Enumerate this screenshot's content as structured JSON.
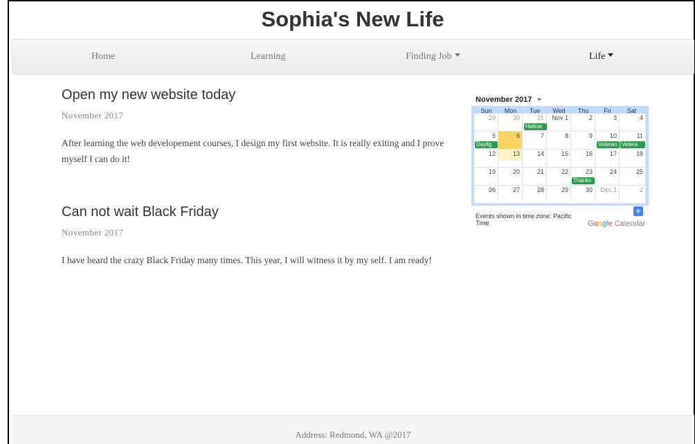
{
  "site": {
    "title": "Sophia's New Life"
  },
  "nav": {
    "items": [
      {
        "label": "Home"
      },
      {
        "label": "Learning"
      },
      {
        "label": "Finding Job"
      },
      {
        "label": "Life"
      }
    ]
  },
  "posts": [
    {
      "title": "Open my new website today",
      "date": "November  2017",
      "body": "After learning the web developement courses, I design my first website. It is really exiting and I prove myself I can do it!"
    },
    {
      "title": "Can not wait Black Friday",
      "date": "November  2017",
      "body": "I have heard the crazy Black Friday many times. This year, I will witness it by my self. I am ready!"
    }
  ],
  "calendar": {
    "month_label": "November 2017",
    "weekdays": [
      "Sun",
      "Mon",
      "Tue",
      "Wed",
      "Thu",
      "Fri",
      "Sat"
    ],
    "weeks": [
      [
        "29",
        "30",
        "31",
        "Nov 1",
        "2",
        "3",
        "4"
      ],
      [
        "5",
        "6",
        "7",
        "8",
        "9",
        "10",
        "11"
      ],
      [
        "12",
        "13",
        "14",
        "15",
        "16",
        "17",
        "18"
      ],
      [
        "19",
        "20",
        "21",
        "22",
        "23",
        "24",
        "25"
      ],
      [
        "26",
        "27",
        "28",
        "29",
        "30",
        "Dec 1",
        "2"
      ]
    ],
    "events": {
      "halloween": "Hallow",
      "daylight": "Daylig",
      "veterans_fri": "Veteran",
      "veterans_sat": "Vetera",
      "thanksgiving": "Thanks"
    },
    "timezone_note": "Events shown in time zone: Pacific Time",
    "brand": {
      "g1": "G",
      "o1": "o",
      "o2": "o",
      "g2": "g",
      "l": "l",
      "e": "e",
      "rest": " Calendar"
    },
    "add_symbol": "+",
    "colors": {
      "header_bg": "#c3d9ff",
      "event": "#2e9a4f",
      "today": "#fad163"
    }
  },
  "footer": {
    "text": "Address: Redmond, WA @2017"
  }
}
